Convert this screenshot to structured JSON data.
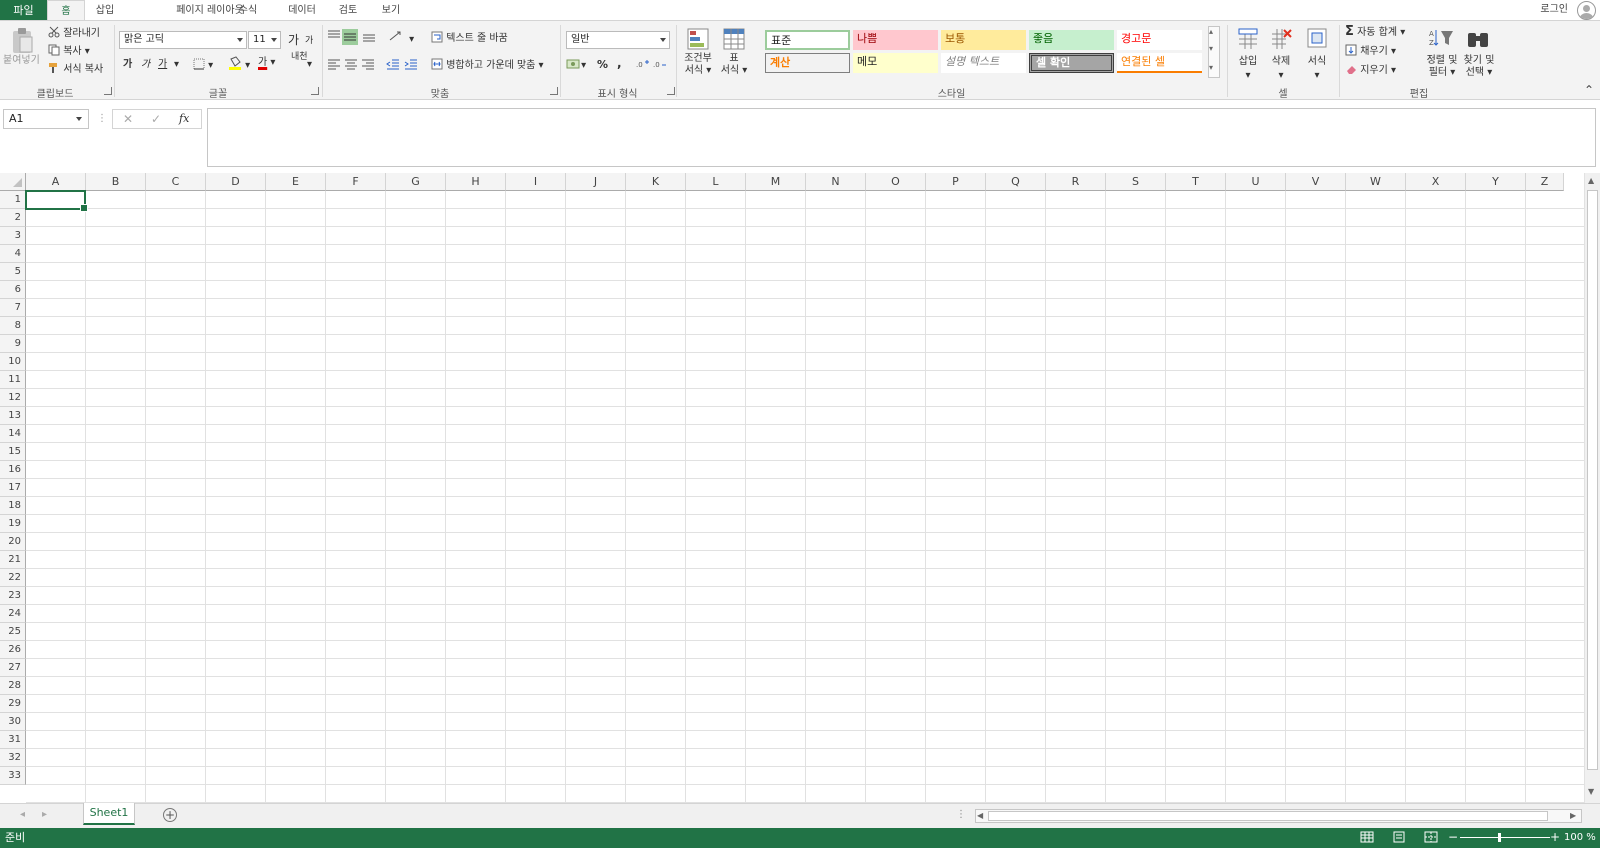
{
  "ribbon_tabs": {
    "file": "파일",
    "home": "홈",
    "insert": "삽입",
    "page_layout": "페이지 레이아웃",
    "formulas": "수식",
    "data": "데이터",
    "review": "검토",
    "view": "보기"
  },
  "account": {
    "login": "로그인"
  },
  "clipboard": {
    "paste": "붙여넣기",
    "cut": "잘라내기",
    "copy": "복사",
    "format_painter": "서식 복사",
    "group": "클립보드"
  },
  "font": {
    "name": "맑은 고딕",
    "size": "11",
    "grow": "가",
    "shrink": "가",
    "bold": "가",
    "italic": "가",
    "underline": "가",
    "font_color_sample": "가",
    "phonetic": "내천",
    "group": "글꼴"
  },
  "alignment": {
    "wrap_text": "텍스트 줄 바꿈",
    "merge_center": "병합하고 가운데 맞춤",
    "group": "맞춤"
  },
  "number": {
    "format": "일반",
    "percent": "%",
    "comma": ",",
    "group": "표시 형식"
  },
  "styles": {
    "conditional_format_1": "조건부",
    "conditional_format_2": "서식",
    "table_format_1": "표",
    "table_format_2": "서식",
    "cells": [
      {
        "label": "표준",
        "bg": "#ffffff",
        "fg": "#222222"
      },
      {
        "label": "나쁨",
        "bg": "#ffc7ce",
        "fg": "#9c0006"
      },
      {
        "label": "보통",
        "bg": "#ffeb9c",
        "fg": "#9c5700"
      },
      {
        "label": "좋음",
        "bg": "#c6efce",
        "fg": "#006100"
      },
      {
        "label": "경고문",
        "bg": "#ffffff",
        "fg": "#ff0000"
      },
      {
        "label": "계산",
        "bg": "#f2f2f2",
        "fg": "#fa7d00"
      },
      {
        "label": "메모",
        "bg": "#ffffcc",
        "fg": "#222222"
      },
      {
        "label": "설명 텍스트",
        "bg": "#ffffff",
        "fg": "#7f7f7f"
      },
      {
        "label": "셀 확인",
        "bg": "#a5a5a5",
        "fg": "#ffffff"
      },
      {
        "label": "연결된 셀",
        "bg": "#ffffff",
        "fg": "#fa7d00"
      }
    ],
    "group": "스타일"
  },
  "cells_group": {
    "insert": "삽입",
    "delete": "삭제",
    "format": "서식",
    "group": "셀"
  },
  "editing": {
    "autosum": "자동 합계",
    "fill": "채우기",
    "clear": "지우기",
    "sort_filter_1": "정렬 및",
    "sort_filter_2": "필터",
    "find_select_1": "찾기 및",
    "find_select_2": "선택",
    "group": "편집"
  },
  "formula_bar": {
    "name_box": "A1",
    "formula": "",
    "cancel": "✕",
    "enter": "✓",
    "fx": "fx"
  },
  "columns": [
    "A",
    "B",
    "C",
    "D",
    "E",
    "F",
    "G",
    "H",
    "I",
    "J",
    "K",
    "L",
    "M",
    "N",
    "O",
    "P",
    "Q",
    "R",
    "S",
    "T",
    "U",
    "V",
    "W",
    "X",
    "Y",
    "Z"
  ],
  "rows": [
    "1",
    "2",
    "3",
    "4",
    "5",
    "6",
    "7",
    "8",
    "9",
    "10",
    "11",
    "12",
    "13",
    "14",
    "15",
    "16",
    "17",
    "18",
    "19",
    "20",
    "21",
    "22",
    "23",
    "24",
    "25",
    "26",
    "27",
    "28",
    "29",
    "30",
    "31",
    "32",
    "33"
  ],
  "sheets": [
    "Sheet1"
  ],
  "add_sheet": "+",
  "status": {
    "ready": "준비",
    "zoom": "100 %",
    "zoom_minus": "−",
    "zoom_plus": "+"
  },
  "colors": {
    "accent": "#217346",
    "ribbon_bg": "#f3f3f3"
  }
}
